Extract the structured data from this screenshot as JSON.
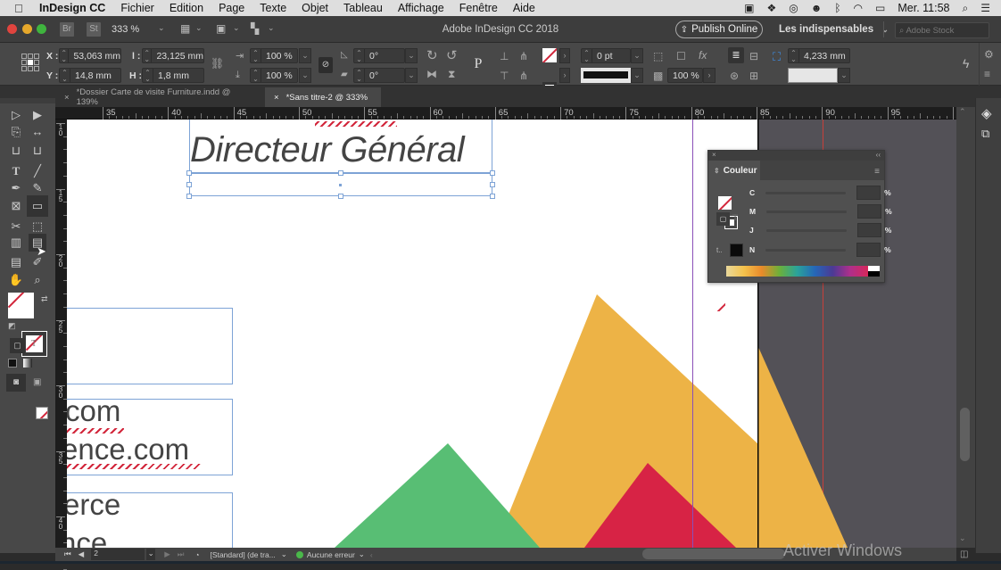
{
  "menubar": {
    "app_name": "InDesign CC",
    "items": [
      "Fichier",
      "Edition",
      "Page",
      "Texte",
      "Objet",
      "Tableau",
      "Affichage",
      "Fenêtre",
      "Aide"
    ],
    "clock": "Mer. 11:58"
  },
  "appbar": {
    "bridge_label": "Br",
    "stock_label": "St",
    "zoom": "333 %",
    "window_title": "Adobe InDesign CC 2018",
    "publish_label": "Publish Online",
    "workspace": "Les indispensables",
    "stock_search_placeholder": "Adobe Stock"
  },
  "control": {
    "x_label": "X :",
    "x_value": "53,063 mm",
    "y_label": "Y :",
    "y_value": "14,8 mm",
    "w_label": "l :",
    "w_value": "23,125 mm",
    "h_label": "H :",
    "h_value": "1,8 mm",
    "scale_x": "100 %",
    "scale_y": "100 %",
    "rotation": "0°",
    "shear": "0°",
    "stroke_weight": "0 pt",
    "opacity": "100 %",
    "corner_size": "4,233 mm"
  },
  "tabs": [
    {
      "label": "*Dossier Carte de visite Furniture.indd @ 139%",
      "active": false
    },
    {
      "label": "*Sans titre-2 @ 333%",
      "active": true
    }
  ],
  "ruler": {
    "h_labels": [
      "35",
      "40",
      "45",
      "50",
      "55",
      "60",
      "65",
      "70",
      "75",
      "80",
      "85",
      "90",
      "95",
      "1"
    ],
    "v_labels": [
      "10",
      "15",
      "20",
      "25",
      "30",
      "35",
      "40"
    ]
  },
  "document": {
    "title_text": "Directeur Général",
    "line1": "com",
    "line2": "ence.com",
    "line3": "erce",
    "line4": "nce",
    "colors": {
      "yellow": "#EDB346",
      "green": "#58BE74",
      "red": "#D72345"
    }
  },
  "color_panel": {
    "title": "Couleur",
    "channels": [
      {
        "label": "C",
        "value": "",
        "unit": "%"
      },
      {
        "label": "M",
        "value": "",
        "unit": "%"
      },
      {
        "label": "J",
        "value": "",
        "unit": "%"
      },
      {
        "label": "N",
        "value": "",
        "unit": "%"
      }
    ]
  },
  "status": {
    "page": "2",
    "preflight_profile": "[Standard] (de tra...",
    "preflight_status": "Aucune erreur"
  },
  "watermark": "Activer Windows"
}
